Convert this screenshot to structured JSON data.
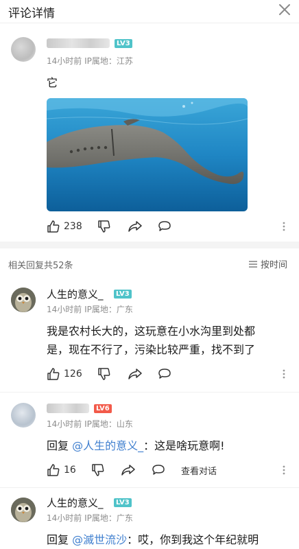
{
  "header": {
    "title": "评论详情"
  },
  "main_comment": {
    "meta": "14小时前 IP属地：江苏",
    "level": "LV3",
    "text": "它",
    "likes": "238"
  },
  "replies_bar": {
    "count_label": "相关回复共52条",
    "sort_label": "按时间"
  },
  "replies": [
    {
      "name": "人生的意义_",
      "level": "LV3",
      "meta": "14小时前 IP属地：广东",
      "text_line1": "我是农村长大的，这玩意在小水沟里到处都",
      "text_line2": "是，现在不行了，污染比较严重，找不到了",
      "likes": "126"
    },
    {
      "level": "LV6",
      "meta": "14小时前 IP属地：山东",
      "reply_prefix": "回复 ",
      "mention": "@人生的意义_",
      "reply_rest": "：这是啥玩意啊!",
      "likes": "16",
      "view_replies": "查看对话"
    },
    {
      "name": "人生的意义_",
      "level": "LV3",
      "meta": "14小时前 IP属地：广东",
      "reply_prefix": "回复 ",
      "mention": "@滅世流沙",
      "reply_rest": "：哎，你到我这个年纪就明"
    }
  ],
  "icons": {
    "close": "close-icon",
    "like": "thumbs-up-icon",
    "dislike": "thumbs-down-icon",
    "share": "share-icon",
    "comment": "comment-icon",
    "more": "more-vertical-icon",
    "sort": "sort-lines-icon"
  },
  "colors": {
    "mention": "#3f7fcf",
    "level_teal": "#4fc3c9",
    "level_red": "#f25a4a",
    "water": "#1f86c4"
  }
}
